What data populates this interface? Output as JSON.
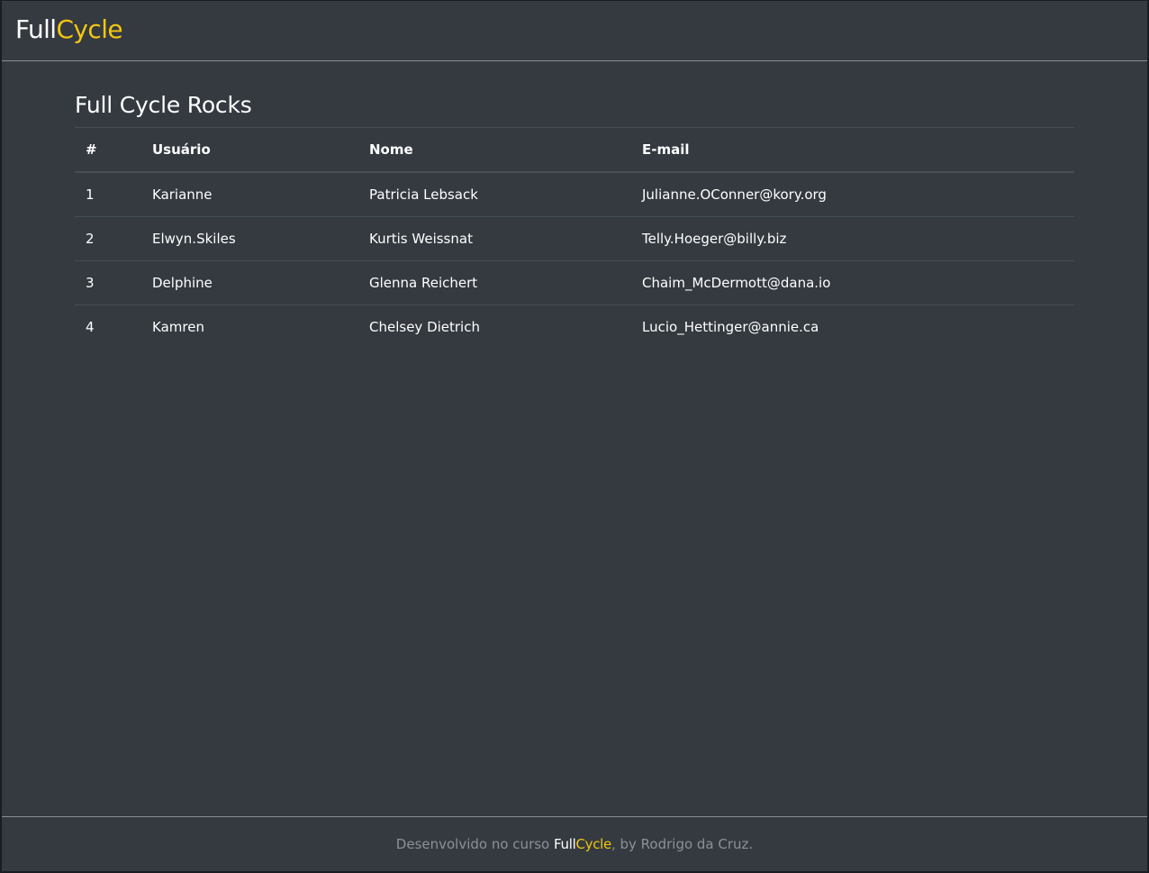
{
  "brand": {
    "part1": "Full",
    "part2": "Cycle"
  },
  "page": {
    "title": "Full Cycle Rocks"
  },
  "table": {
    "headers": [
      "#",
      "Usuário",
      "Nome",
      "E-mail"
    ],
    "rows": [
      {
        "id": "1",
        "user": "Karianne",
        "name": "Patricia Lebsack",
        "email": "Julianne.OConner@kory.org"
      },
      {
        "id": "2",
        "user": "Elwyn.Skiles",
        "name": "Kurtis Weissnat",
        "email": "Telly.Hoeger@billy.biz"
      },
      {
        "id": "3",
        "user": "Delphine",
        "name": "Glenna Reichert",
        "email": "Chaim_McDermott@dana.io"
      },
      {
        "id": "4",
        "user": "Kamren",
        "name": "Chelsey Dietrich",
        "email": "Lucio_Hettinger@annie.ca"
      }
    ]
  },
  "footer": {
    "prefix": "Desenvolvido no curso ",
    "brand_part1": "Full",
    "brand_part2": "Cycle",
    "suffix": ", by Rodrigo da Cruz."
  },
  "colors": {
    "background": "#343a40",
    "brand_accent": "#f3c611",
    "text": "#ffffff",
    "footer_text": "#8b9196"
  }
}
